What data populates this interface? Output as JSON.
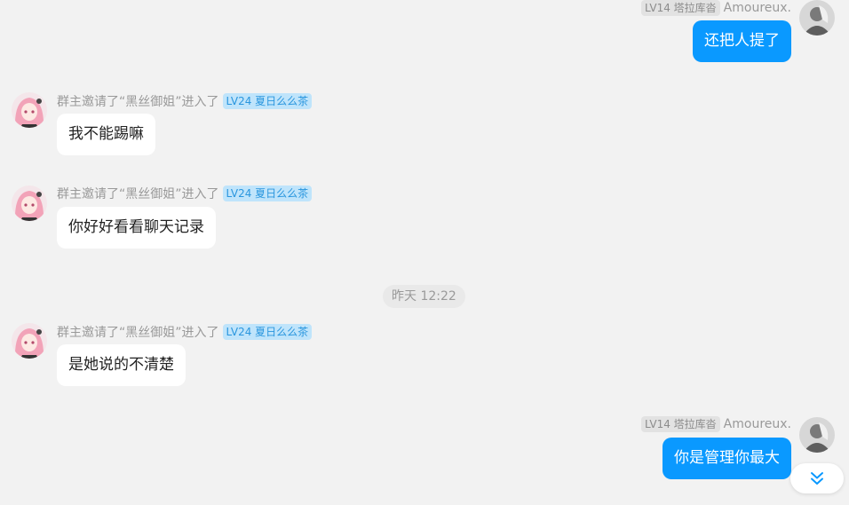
{
  "accent_color": "#0a99ff",
  "messages": [
    {
      "side": "right",
      "nickname": "Amoureux.",
      "level_tag": "LV14 塔拉库沓",
      "text": "还把人提了",
      "avatar_icon": "user-avatar-icon"
    },
    {
      "side": "left",
      "nickname": "群主邀请了“黑丝御姐”进入了",
      "level_tag": "LV24 夏日么么茶",
      "text": "我不能踢嘛",
      "avatar_icon": "anime-girl-avatar-icon"
    },
    {
      "side": "left",
      "nickname": "群主邀请了“黑丝御姐”进入了",
      "level_tag": "LV24 夏日么么茶",
      "text": "你好好看看聊天记录",
      "avatar_icon": "anime-girl-avatar-icon"
    },
    {
      "side": "left",
      "nickname": "群主邀请了“黑丝御姐”进入了",
      "level_tag": "LV24 夏日么么茶",
      "text": "是她说的不清楚",
      "avatar_icon": "anime-girl-avatar-icon"
    },
    {
      "side": "right",
      "nickname": "Amoureux.",
      "level_tag": "LV14 塔拉库沓",
      "text": "你是管理你最大",
      "avatar_icon": "user-avatar-icon"
    }
  ],
  "timestamp": "昨天 12:22",
  "scroll_button_icon": "double-chevron-down-icon"
}
